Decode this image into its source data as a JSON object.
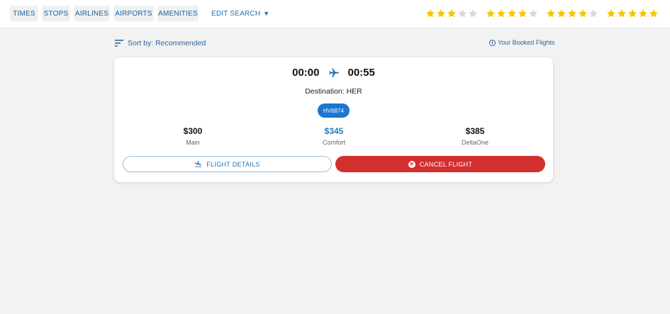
{
  "filters": [
    {
      "label": "TIMES"
    },
    {
      "label": "STOPS"
    },
    {
      "label": "AIRLINES"
    },
    {
      "label": "AIRPORTS"
    },
    {
      "label": "AMENITIES"
    }
  ],
  "edit_search": {
    "label": "EDIT SEARCH",
    "caret": "▼"
  },
  "ratings": [
    {
      "filled": 3,
      "total": 5
    },
    {
      "filled": 4,
      "total": 5
    },
    {
      "filled": 4,
      "total": 5
    },
    {
      "filled": 5,
      "total": 5
    }
  ],
  "sort": {
    "label": "Sort by: Recommended"
  },
  "booked": {
    "label": "Your Booked Flights",
    "icon_glyph": "i"
  },
  "flight": {
    "depart": "00:00",
    "arrive": "00:55",
    "destination": "Destination: HER",
    "code": "HV6874",
    "fares": [
      {
        "price": "$300",
        "class": "Main"
      },
      {
        "price": "$345",
        "class": "Comfort"
      },
      {
        "price": "$385",
        "class": "DeltaOne"
      }
    ],
    "details_button": "FLIGHT DETAILS",
    "cancel_button": "CANCEL FLIGHT",
    "cancel_glyph": "✕"
  },
  "colors": {
    "accent": "#1976d2",
    "link": "#1f6fb2",
    "danger": "#d32f2f",
    "star_on": "#f6c600",
    "star_off": "#d9d9d9"
  }
}
